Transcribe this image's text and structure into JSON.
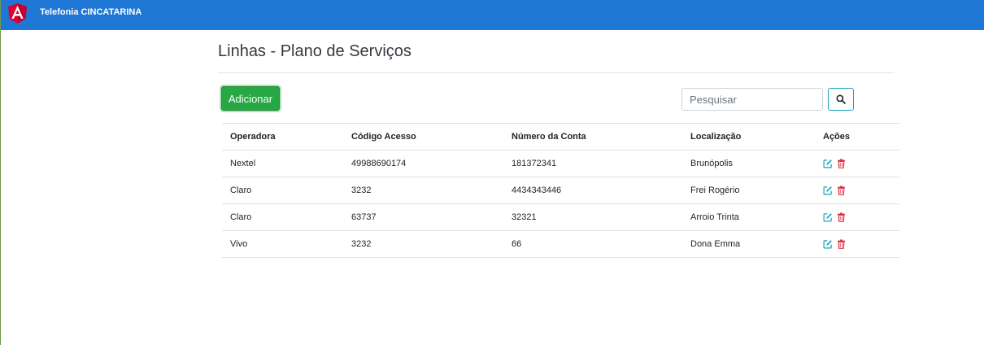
{
  "navbar": {
    "brand": "Telefonia CINCATARINA",
    "logo_icon": "angular-logo-icon",
    "bg_color": "#1e77d4",
    "logo_color": "#dd0031"
  },
  "page": {
    "title": "Linhas - Plano de Serviços"
  },
  "toolbar": {
    "add_label": "Adicionar",
    "add_color": "#28a745",
    "search_placeholder": "Pesquisar",
    "search_value": "",
    "search_icon": "search-icon",
    "search_btn_color": "#17a2b8"
  },
  "table": {
    "headers": {
      "operadora": "Operadora",
      "codigo": "Código Acesso",
      "numero": "Número da Conta",
      "localizacao": "Localização",
      "acoes": "Ações"
    },
    "rows": [
      {
        "operadora": "Nextel",
        "codigo": "49988690174",
        "numero": "181372341",
        "localizacao": "Brunópolis"
      },
      {
        "operadora": "Claro",
        "codigo": "3232",
        "numero": "4434343446",
        "localizacao": "Frei Rogério"
      },
      {
        "operadora": "Claro",
        "codigo": "63737",
        "numero": "32321",
        "localizacao": "Arroio Trinta"
      },
      {
        "operadora": "Vivo",
        "codigo": "3232",
        "numero": "66",
        "localizacao": "Dona Emma"
      }
    ],
    "edit_icon": "edit-icon",
    "delete_icon": "trash-icon",
    "edit_color": "#17a2b8",
    "delete_color": "#dc3545"
  }
}
